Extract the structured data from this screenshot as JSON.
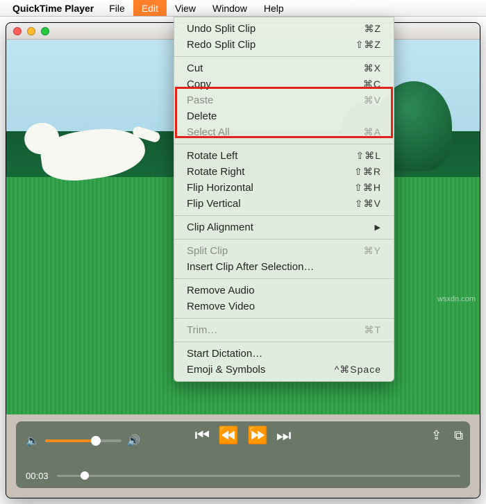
{
  "menubar": {
    "app_name": "QuickTime Player",
    "items": [
      "File",
      "Edit",
      "View",
      "Window",
      "Help"
    ],
    "active_index": 1
  },
  "dropdown": {
    "groups": [
      [
        {
          "label": "Undo Split Clip",
          "shortcut": "⌘Z",
          "disabled": false
        },
        {
          "label": "Redo Split Clip",
          "shortcut": "⇧⌘Z",
          "disabled": false
        }
      ],
      [
        {
          "label": "Cut",
          "shortcut": "⌘X",
          "disabled": false
        },
        {
          "label": "Copy",
          "shortcut": "⌘C",
          "disabled": false
        },
        {
          "label": "Paste",
          "shortcut": "⌘V",
          "disabled": true
        },
        {
          "label": "Delete",
          "shortcut": "",
          "disabled": false
        },
        {
          "label": "Select All",
          "shortcut": "⌘A",
          "disabled": true
        }
      ],
      [
        {
          "label": "Rotate Left",
          "shortcut": "⇧⌘L",
          "disabled": false
        },
        {
          "label": "Rotate Right",
          "shortcut": "⇧⌘R",
          "disabled": false
        },
        {
          "label": "Flip Horizontal",
          "shortcut": "⇧⌘H",
          "disabled": false
        },
        {
          "label": "Flip Vertical",
          "shortcut": "⇧⌘V",
          "disabled": false
        }
      ],
      [
        {
          "label": "Clip Alignment",
          "shortcut": "",
          "disabled": false,
          "submenu": true
        }
      ],
      [
        {
          "label": "Split Clip",
          "shortcut": "⌘Y",
          "disabled": true
        },
        {
          "label": "Insert Clip After Selection…",
          "shortcut": "",
          "disabled": false
        }
      ],
      [
        {
          "label": "Remove Audio",
          "shortcut": "",
          "disabled": false
        },
        {
          "label": "Remove Video",
          "shortcut": "",
          "disabled": false
        }
      ],
      [
        {
          "label": "Trim…",
          "shortcut": "⌘T",
          "disabled": true
        }
      ],
      [
        {
          "label": "Start Dictation…",
          "shortcut": "",
          "disabled": false
        },
        {
          "label": "Emoji & Symbols",
          "shortcut": "^⌘Space",
          "disabled": false
        }
      ]
    ]
  },
  "player": {
    "current_time": "00:03",
    "volume_percent": 62
  },
  "watermark": "wsxdn.com",
  "icons": {
    "volume_low": "🔈",
    "volume_high": "🔊",
    "skip_back": "⏮",
    "rewind": "⏪",
    "forward": "⏩",
    "skip_fwd": "⏭",
    "share": "⇪",
    "pip": "⧉",
    "submenu_arrow": "▶"
  }
}
